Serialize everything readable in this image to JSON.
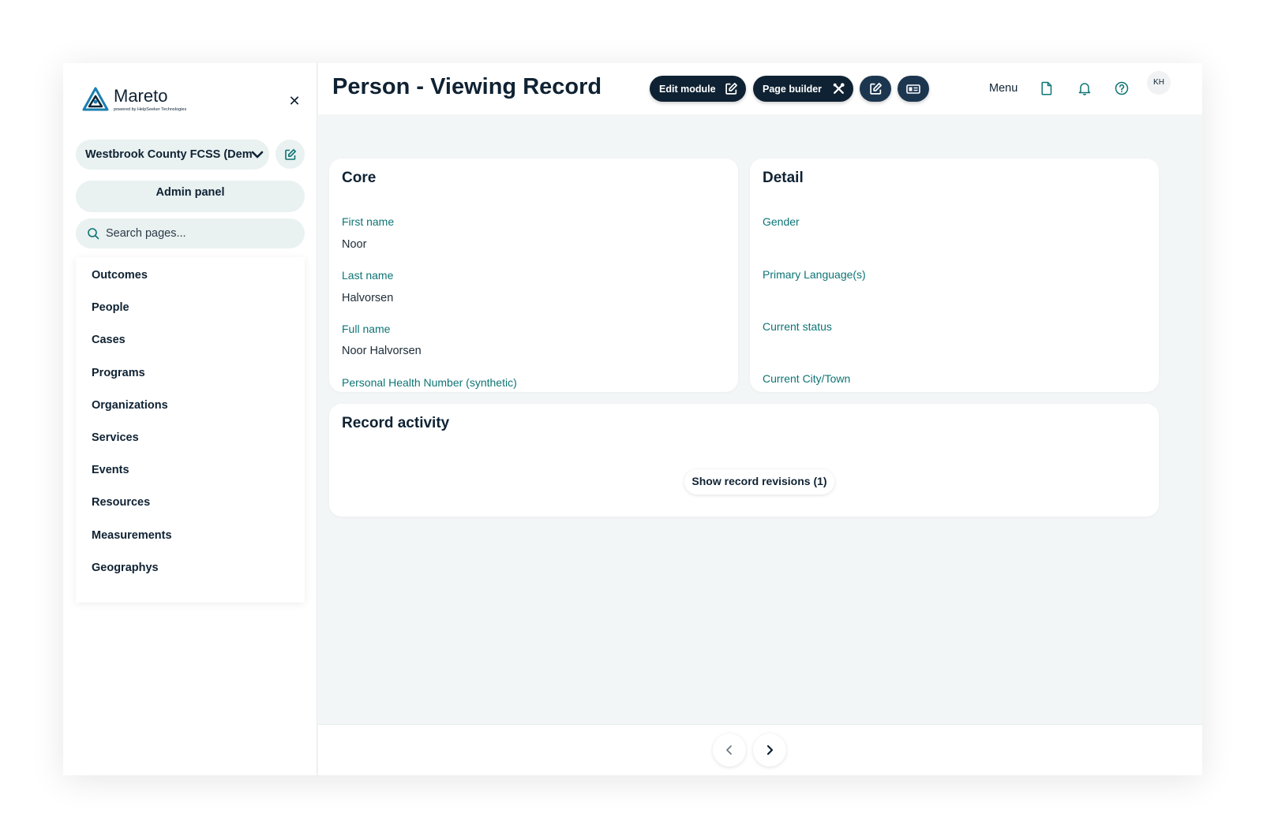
{
  "app": {
    "logo_name": "Mareto",
    "logo_tagline": "powered by HelpSeeker Technologies"
  },
  "sidebar": {
    "organization": "Westbrook County FCSS (Demonstration)",
    "admin_label": "Admin panel",
    "search_placeholder": "Search pages...",
    "items": [
      {
        "label": "Outcomes"
      },
      {
        "label": "People"
      },
      {
        "label": "Cases"
      },
      {
        "label": "Programs"
      },
      {
        "label": "Organizations"
      },
      {
        "label": "Services"
      },
      {
        "label": "Events"
      },
      {
        "label": "Resources"
      },
      {
        "label": "Measurements"
      },
      {
        "label": "Geographys"
      }
    ]
  },
  "header": {
    "title": "Person - Viewing Record",
    "edit_module_label": "Edit module",
    "page_builder_label": "Page builder",
    "menu_label": "Menu",
    "avatar_initials": "KH"
  },
  "core": {
    "title": "Core",
    "fields": [
      {
        "label": "First name",
        "value": "Noor"
      },
      {
        "label": "Last name",
        "value": "Halvorsen"
      },
      {
        "label": "Full name",
        "value": "Noor Halvorsen"
      },
      {
        "label": "Personal Health Number (synthetic)",
        "value": ""
      }
    ]
  },
  "detail": {
    "title": "Detail",
    "fields": [
      {
        "label": "Gender",
        "value": ""
      },
      {
        "label": "Primary Language(s)",
        "value": ""
      },
      {
        "label": "Current status",
        "value": ""
      },
      {
        "label": "Current City/Town",
        "value": ""
      }
    ]
  },
  "activity": {
    "title": "Record activity",
    "revisions_label": "Show record revisions (1)"
  },
  "colors": {
    "navy": "#0f2233",
    "teal_label": "#0e7474",
    "logo_blue": "#1a7fb0",
    "sidebar_pill": "#e9f1f1"
  }
}
